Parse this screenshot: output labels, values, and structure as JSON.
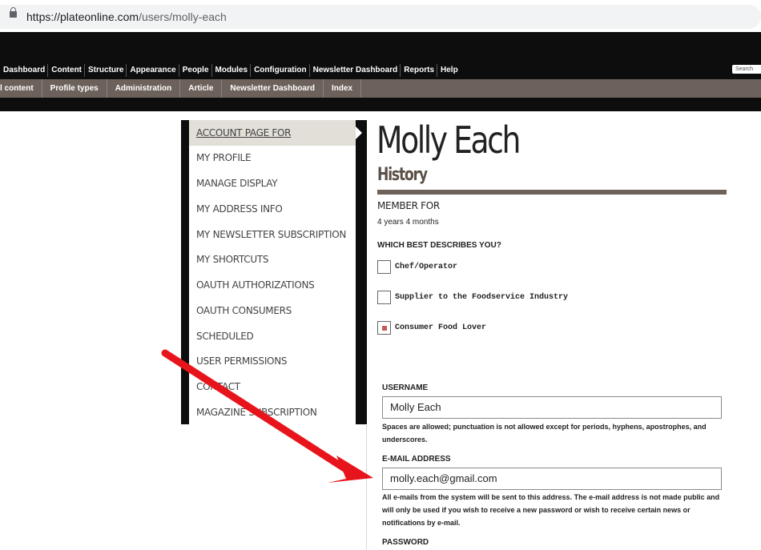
{
  "browser": {
    "url_host": "https://plateonline.com",
    "url_path": "/users/molly-each"
  },
  "admin_menu": [
    "Dashboard",
    "Content",
    "Structure",
    "Appearance",
    "People",
    "Modules",
    "Configuration",
    "Newsletter Dashboard",
    "Reports",
    "Help"
  ],
  "search_placeholder": "Search",
  "shortcuts": [
    "l content",
    "Profile types",
    "Administration",
    "Article",
    "Newsletter Dashboard",
    "Index"
  ],
  "sidebar": {
    "items": [
      {
        "label": "ACCOUNT PAGE FOR",
        "active": true
      },
      {
        "label": "MY PROFILE"
      },
      {
        "label": "MANAGE DISPLAY"
      },
      {
        "label": "MY ADDRESS INFO"
      },
      {
        "label": "MY NEWSLETTER SUBSCRIPTION"
      },
      {
        "label": "MY SHORTCUTS"
      },
      {
        "label": "OAUTH AUTHORIZATIONS"
      },
      {
        "label": "OAUTH CONSUMERS"
      },
      {
        "label": "SCHEDULED"
      },
      {
        "label": "USER PERMISSIONS"
      },
      {
        "label": "CONTACT"
      },
      {
        "label": "MAGAZINE SUBSCRIPTION"
      }
    ]
  },
  "profile": {
    "name": "Molly Each",
    "section_title": "History",
    "member_for_label": "MEMBER FOR",
    "member_for_value": "4 years 4 months",
    "question": "WHICH BEST DESCRIBES YOU?",
    "options": [
      {
        "label": "Chef/Operator",
        "checked": false
      },
      {
        "label": "Supplier to the Foodservice Industry",
        "checked": false
      },
      {
        "label": "Consumer Food Lover",
        "checked": true
      }
    ]
  },
  "form": {
    "username_label": "USERNAME",
    "username_value": "Molly Each",
    "username_help": "Spaces are allowed; punctuation is not allowed except for periods, hyphens, apostrophes, and underscores.",
    "email_label": "E-MAIL ADDRESS",
    "email_value": "molly.each@gmail.com",
    "email_help": "All e-mails from the system will be sent to this address. The e-mail address is not made public and will only be used if you wish to receive a new password or wish to receive certain news or notifications by e-mail.",
    "password_label": "PASSWORD"
  },
  "colors": {
    "toolbar": "#0d0d0d",
    "shortcut_bar": "#6d625b",
    "checkbox_accent": "#c45b5b",
    "annotation_arrow": "#e8141c"
  }
}
